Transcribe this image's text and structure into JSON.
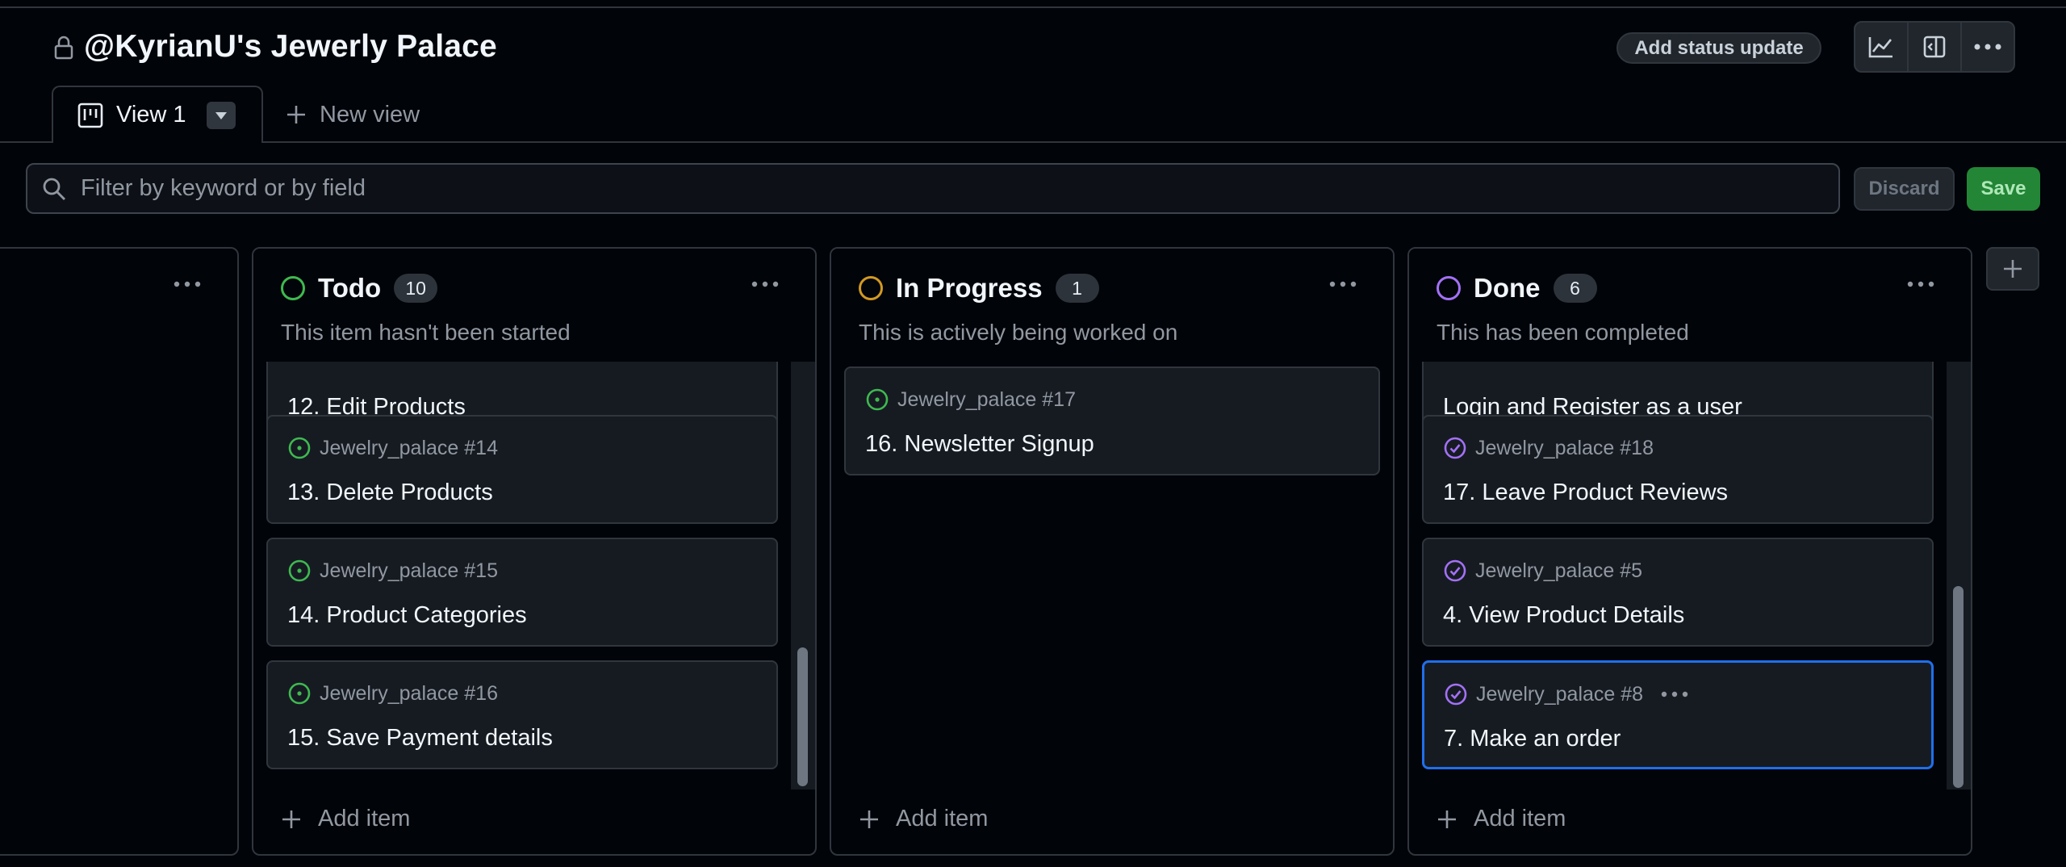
{
  "project": {
    "title": "@KyrianU's Jewerly Palace",
    "status_button": "Add status update"
  },
  "toolbar": {
    "insights_icon": "graph-icon",
    "panel_icon": "sidebar-expand-icon",
    "more_icon": "kebab-horizontal-icon"
  },
  "tabs": {
    "active_label": "View 1",
    "new_view_label": "New view"
  },
  "filter": {
    "placeholder": "Filter by keyword or by field",
    "value": "",
    "discard_label": "Discard",
    "save_label": "Save"
  },
  "colors": {
    "todo": "#3fb950",
    "in_progress": "#d29922",
    "done": "#a371f7",
    "selected_border": "#1f6feb",
    "save_bg": "#238636"
  },
  "columns": {
    "todo": {
      "name": "Todo",
      "count": "10",
      "description": "This item hasn't been started",
      "cards": [
        {
          "ref": "",
          "title": "12. Edit Products"
        },
        {
          "ref": "Jewelry_palace #14",
          "title": "13. Delete Products"
        },
        {
          "ref": "Jewelry_palace #15",
          "title": "14. Product Categories"
        },
        {
          "ref": "Jewelry_palace #16",
          "title": "15. Save Payment details"
        }
      ],
      "add_item": "Add item"
    },
    "in_progress": {
      "name": "In Progress",
      "count": "1",
      "description": "This is actively being worked on",
      "cards": [
        {
          "ref": "Jewelry_palace #17",
          "title": "16. Newsletter Signup"
        }
      ],
      "add_item": "Add item"
    },
    "done": {
      "name": "Done",
      "count": "6",
      "description": "This has been completed",
      "cards": [
        {
          "ref": "",
          "title": "Login and Register as a user"
        },
        {
          "ref": "Jewelry_palace #18",
          "title": "17. Leave Product Reviews"
        },
        {
          "ref": "Jewelry_palace #5",
          "title": "4. View Product Details"
        },
        {
          "ref": "Jewelry_palace #8",
          "title": "7. Make an order"
        }
      ],
      "add_item": "Add item"
    }
  }
}
